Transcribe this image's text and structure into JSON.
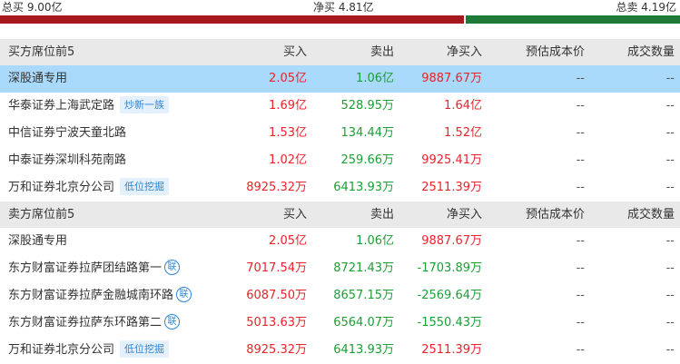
{
  "summary": {
    "total_buy": "总买 9.00亿",
    "net_buy": "净买 4.81亿",
    "total_sell": "总卖 4.19亿",
    "buy_ratio": 0.682
  },
  "colors": {
    "buy_bar": "#a8181f",
    "sell_bar": "#1f7a37",
    "up": "#e8232a",
    "down": "#1aa034",
    "highlight": "#a9d9fb",
    "header": "#e9e9e9"
  },
  "columns": [
    "预估成本价",
    "成交数量"
  ],
  "buy_section": {
    "header": {
      "name": "买方席位前5",
      "buy": "买入",
      "sell": "卖出",
      "net": "净买入",
      "cost": "预估成本价",
      "qty": "成交数量"
    },
    "rows": [
      {
        "name": "深股通专用",
        "tag": "",
        "lian": "",
        "buy": "2.05亿",
        "sell": "1.06亿",
        "net": "9887.67万",
        "net_dir": "up",
        "cost": "--",
        "qty": "--",
        "highlight": true
      },
      {
        "name": "华泰证券上海武定路",
        "tag": "炒新一族",
        "lian": "",
        "buy": "1.69亿",
        "sell": "528.95万",
        "net": "1.64亿",
        "net_dir": "up",
        "cost": "--",
        "qty": "--",
        "highlight": false
      },
      {
        "name": "中信证券宁波天童北路",
        "tag": "",
        "lian": "",
        "buy": "1.53亿",
        "sell": "134.44万",
        "net": "1.52亿",
        "net_dir": "up",
        "cost": "--",
        "qty": "--",
        "highlight": false
      },
      {
        "name": "中泰证券深圳科苑南路",
        "tag": "",
        "lian": "",
        "buy": "1.02亿",
        "sell": "259.66万",
        "net": "9925.41万",
        "net_dir": "up",
        "cost": "--",
        "qty": "--",
        "highlight": false
      },
      {
        "name": "万和证券北京分公司",
        "tag": "低位挖掘",
        "lian": "",
        "buy": "8925.32万",
        "sell": "6413.93万",
        "net": "2511.39万",
        "net_dir": "up",
        "cost": "--",
        "qty": "--",
        "highlight": false
      }
    ]
  },
  "sell_section": {
    "header": {
      "name": "卖方席位前5",
      "buy": "买入",
      "sell": "卖出",
      "net": "净买入",
      "cost": "预估成本价",
      "qty": "成交数量"
    },
    "rows": [
      {
        "name": "深股通专用",
        "tag": "",
        "lian": "",
        "buy": "2.05亿",
        "sell": "1.06亿",
        "net": "9887.67万",
        "net_dir": "up",
        "cost": "--",
        "qty": "--",
        "highlight": false
      },
      {
        "name": "东方财富证券拉萨团结路第一",
        "tag": "",
        "lian": "联",
        "buy": "7017.54万",
        "sell": "8721.43万",
        "net": "-1703.89万",
        "net_dir": "down",
        "cost": "--",
        "qty": "--",
        "highlight": false
      },
      {
        "name": "东方财富证券拉萨金融城南环路",
        "tag": "",
        "lian": "联",
        "buy": "6087.50万",
        "sell": "8657.15万",
        "net": "-2569.64万",
        "net_dir": "down",
        "cost": "--",
        "qty": "--",
        "highlight": false
      },
      {
        "name": "东方财富证券拉萨东环路第二",
        "tag": "",
        "lian": "联",
        "buy": "5013.63万",
        "sell": "6564.07万",
        "net": "-1550.43万",
        "net_dir": "down",
        "cost": "--",
        "qty": "--",
        "highlight": false
      },
      {
        "name": "万和证券北京分公司",
        "tag": "低位挖掘",
        "lian": "",
        "buy": "8925.32万",
        "sell": "6413.93万",
        "net": "2511.39万",
        "net_dir": "up",
        "cost": "--",
        "qty": "--",
        "highlight": false
      }
    ]
  }
}
